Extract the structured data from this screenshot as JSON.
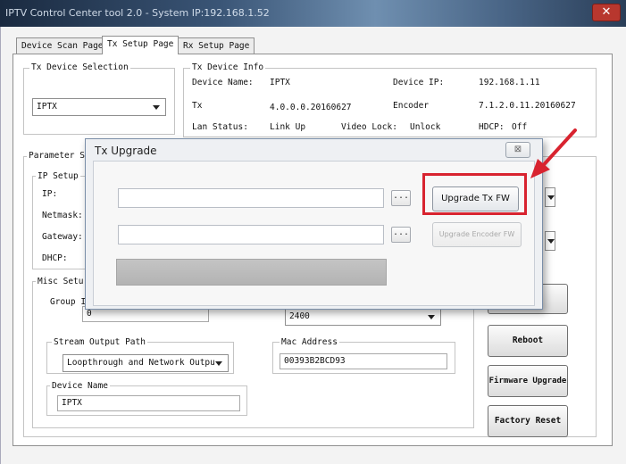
{
  "window": {
    "title": "IPTV Control Center tool 2.0 - System IP:192.168.1.52",
    "close_glyph": "✕"
  },
  "tabs": [
    {
      "label": "Device Scan Page"
    },
    {
      "label": "Tx Setup Page"
    },
    {
      "label": "Rx Setup Page"
    }
  ],
  "tx_device_selection": {
    "label": "Tx Device Selection",
    "selected": "IPTX"
  },
  "tx_device_info": {
    "label": "Tx Device Info",
    "device_name_label": "Device Name:",
    "device_name": "IPTX",
    "device_ip_label": "Device IP:",
    "device_ip": "192.168.1.11",
    "tx_label": "Tx",
    "tx_version": "4.0.0.0.20160627",
    "encoder_label": "Encoder",
    "encoder_version": "7.1.2.0.11.20160627",
    "lan_status_label": "Lan Status:",
    "lan_status": "Link Up",
    "video_lock_label": "Video Lock:",
    "video_lock": "Unlock",
    "hdcp_label": "HDCP:",
    "hdcp": "Off"
  },
  "parameter_setup": {
    "label": "Parameter S",
    "ip_setup_label": "IP Setup",
    "ip_label": "IP:",
    "netmask_label": "Netmask:",
    "gateway_label": "Gateway:",
    "dhcp_label": "DHCP:"
  },
  "misc_setup": {
    "label": "Misc Setu",
    "group_label": "Group I",
    "group_value": "0",
    "bitrate_value": "2400",
    "stream_output_label": "Stream Output Path",
    "stream_output_value": "Loopthrough and Network Outpu",
    "mac_label": "Mac Address",
    "mac_value": "00393B2BCD93",
    "device_name_label": "Device Name",
    "device_name_value": "IPTX"
  },
  "actions": {
    "reboot": "Reboot",
    "firmware_upgrade": "Firmware Upgrade",
    "factory_reset": "Factory Reset"
  },
  "dialog": {
    "title": "Tx Upgrade",
    "close_glyph": "⊠",
    "browse_label": "...",
    "upgrade_tx_fw": "Upgrade Tx FW",
    "upgrade_encoder_fw": "Upgrade Encoder FW"
  },
  "annotation_color": "#d8232f"
}
